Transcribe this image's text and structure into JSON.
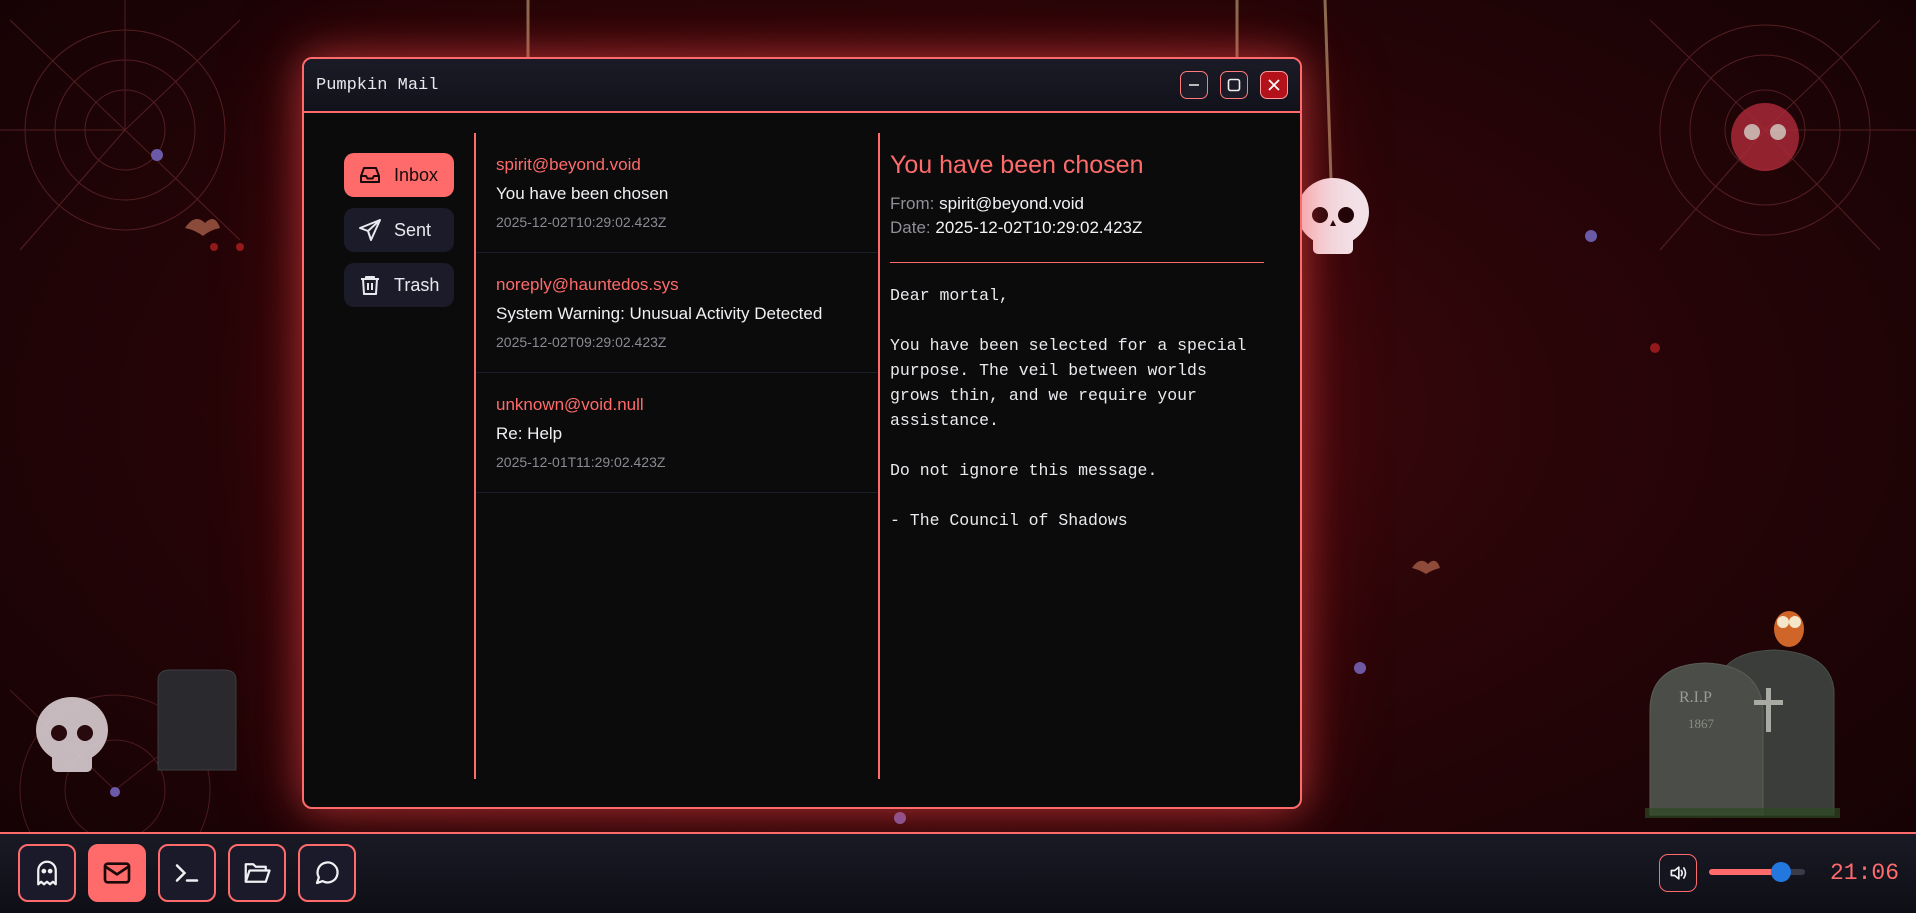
{
  "window": {
    "title": "Pumpkin Mail"
  },
  "nav": [
    {
      "label": "Inbox",
      "icon": "inbox-icon",
      "active": true
    },
    {
      "label": "Sent",
      "icon": "send-icon",
      "active": false
    },
    {
      "label": "Trash",
      "icon": "trash-icon",
      "active": false
    }
  ],
  "emails": [
    {
      "from": "spirit@beyond.void",
      "subject": "You have been chosen",
      "date": "2025-12-02T10:29:02.423Z"
    },
    {
      "from": "noreply@hauntedos.sys",
      "subject": "System Warning: Unusual Activity Detected",
      "date": "2025-12-02T09:29:02.423Z"
    },
    {
      "from": "unknown@void.null",
      "subject": "Re: Help",
      "date": "2025-12-01T11:29:02.423Z"
    }
  ],
  "reader": {
    "subject": "You have been chosen",
    "from_label": "From:",
    "from": "spirit@beyond.void",
    "date_label": "Date:",
    "date": "2025-12-02T10:29:02.423Z",
    "body": "Dear mortal,\n\nYou have been selected for a special purpose. The veil between worlds grows thin, and we require your assistance.\n\nDo not ignore this message.\n\n- The Council of Shadows"
  },
  "decor": {
    "tombstone_text": "R.I.P",
    "tombstone_year": "1867"
  },
  "taskbar": {
    "apps": [
      {
        "name": "ghost-icon",
        "active": false
      },
      {
        "name": "mail-icon",
        "active": true
      },
      {
        "name": "terminal-icon",
        "active": false
      },
      {
        "name": "folder-icon",
        "active": false
      },
      {
        "name": "chat-icon",
        "active": false
      }
    ],
    "volume": 0.75,
    "clock": "21:06"
  },
  "colors": {
    "accent": "#ff6b6b",
    "window_bg": "#0b0b0c",
    "taskbar_bg": "#14141f",
    "knob": "#2378e0"
  }
}
